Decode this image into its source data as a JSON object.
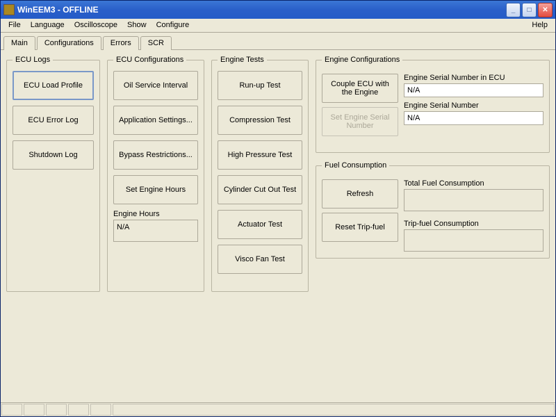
{
  "window": {
    "title": "WinEEM3 - OFFLINE"
  },
  "menu": {
    "file": "File",
    "language": "Language",
    "oscilloscope": "Oscilloscope",
    "show": "Show",
    "configure": "Configure",
    "help": "Help"
  },
  "tabs": {
    "main": "Main",
    "configurations": "Configurations",
    "errors": "Errors",
    "scr": "SCR"
  },
  "ecu_logs": {
    "legend": "ECU Logs",
    "load_profile": "ECU Load Profile",
    "error_log": "ECU Error Log",
    "shutdown_log": "Shutdown Log"
  },
  "ecu_conf": {
    "legend": "ECU Configurations",
    "oil": "Oil Service Interval",
    "app_settings": "Application Settings...",
    "bypass": "Bypass Restrictions...",
    "set_hours": "Set Engine Hours",
    "hours_label": "Engine Hours",
    "hours_value": "N/A"
  },
  "engine_tests": {
    "legend": "Engine Tests",
    "runup": "Run-up Test",
    "compression": "Compression Test",
    "high_pressure": "High Pressure Test",
    "cutout": "Cylinder Cut Out Test",
    "actuator": "Actuator Test",
    "visco": "Visco Fan Test"
  },
  "engine_conf": {
    "legend": "Engine Configurations",
    "couple": "Couple ECU with the Engine",
    "set_serial": "Set Engine Serial Number",
    "serial_ecu_label": "Engine Serial Number in ECU",
    "serial_ecu_value": "N/A",
    "serial_label": "Engine Serial Number",
    "serial_value": "N/A"
  },
  "fuel": {
    "legend": "Fuel Consumption",
    "refresh": "Refresh",
    "reset": "Reset Trip-fuel",
    "total_label": "Total Fuel Consumption",
    "total_value": "",
    "trip_label": "Trip-fuel Consumption",
    "trip_value": ""
  }
}
